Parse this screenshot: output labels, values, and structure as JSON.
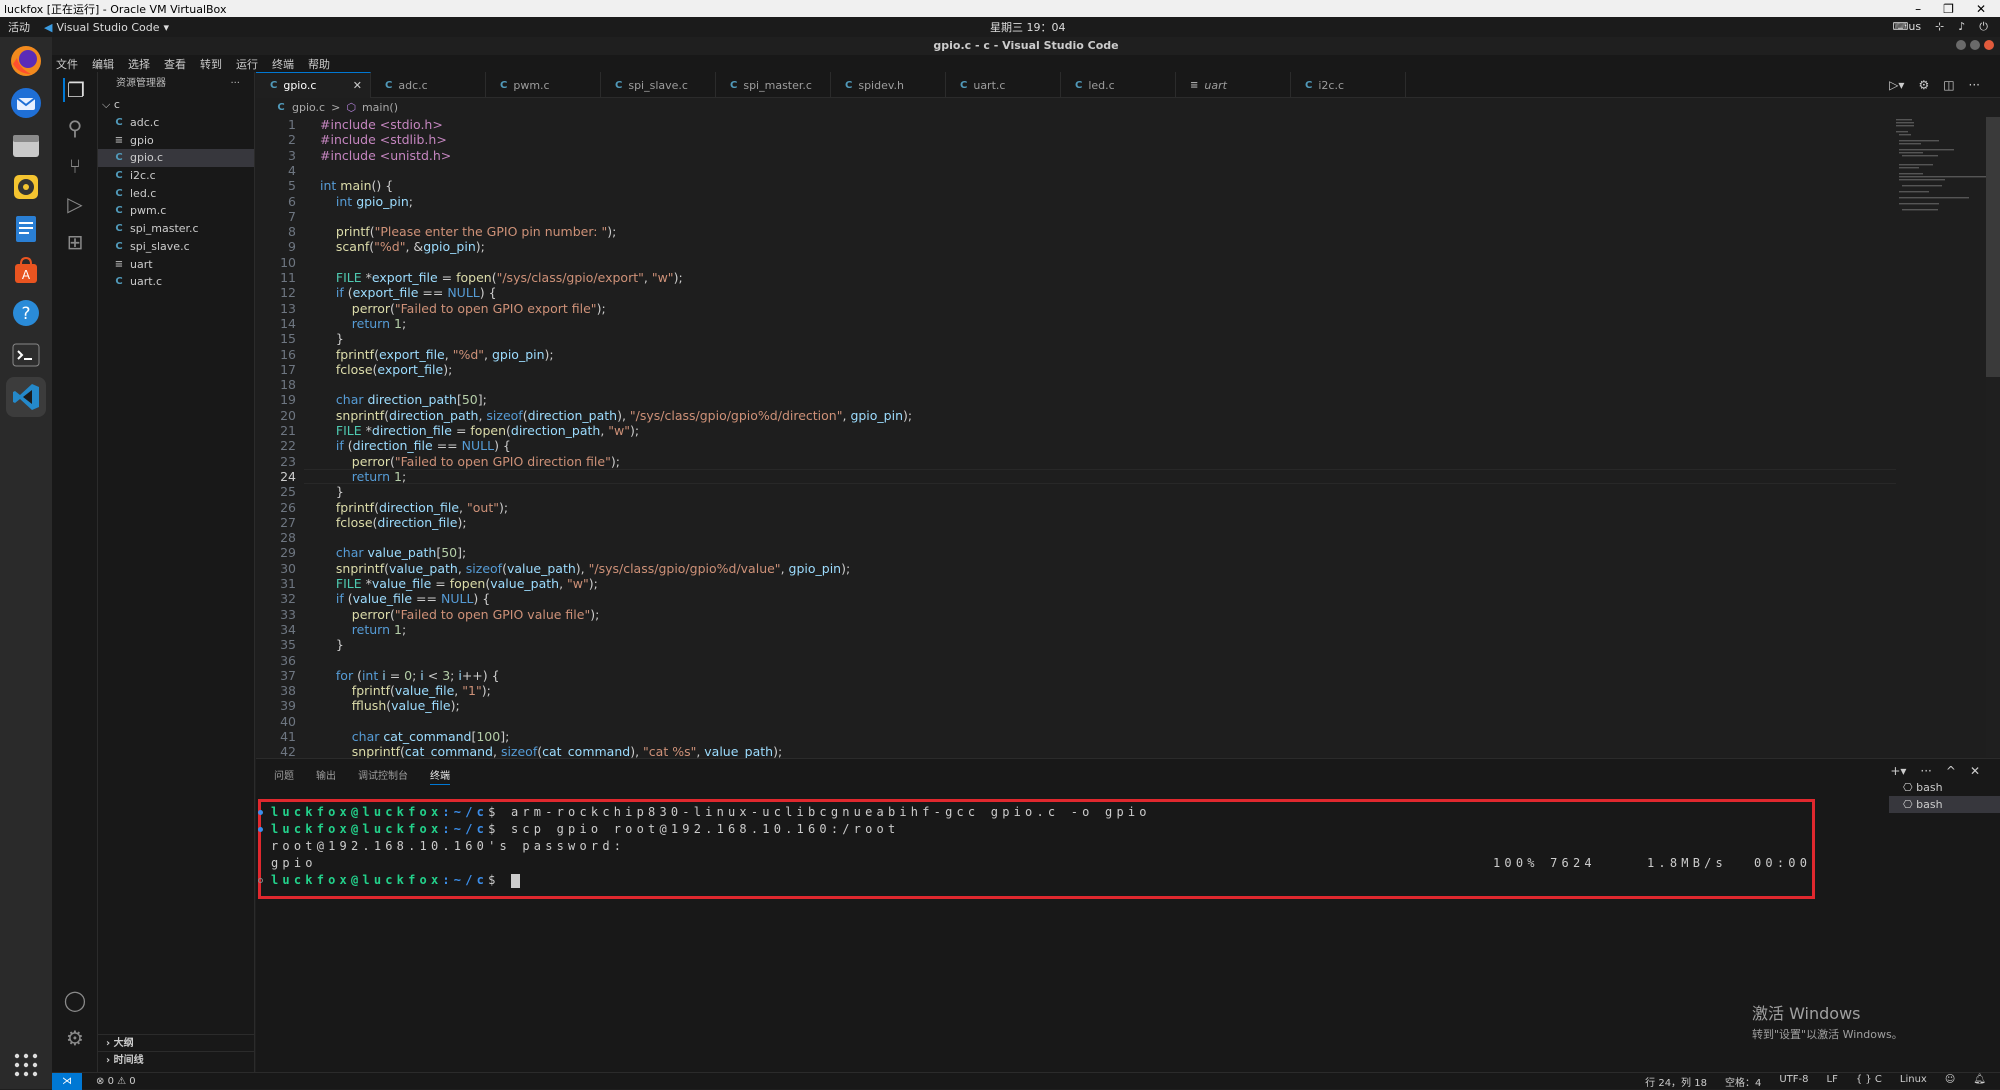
{
  "vbox": {
    "title": "luckfox [正在运行] - Oracle VM VirtualBox"
  },
  "gnome": {
    "activities": "活动",
    "app": "Visual Studio Code",
    "clock": "星期三 19：04",
    "lang": "us"
  },
  "window": {
    "title": "gpio.c - c - Visual Studio Code"
  },
  "menu": [
    "文件",
    "编辑",
    "选择",
    "查看",
    "转到",
    "运行",
    "终端",
    "帮助"
  ],
  "explorer": {
    "title": "资源管理器",
    "more": "···",
    "folder": "c",
    "files": [
      {
        "name": "adc.c",
        "type": "C"
      },
      {
        "name": "gpio",
        "type": "≡"
      },
      {
        "name": "gpio.c",
        "type": "C"
      },
      {
        "name": "i2c.c",
        "type": "C"
      },
      {
        "name": "led.c",
        "type": "C"
      },
      {
        "name": "pwm.c",
        "type": "C"
      },
      {
        "name": "spi_master.c",
        "type": "C"
      },
      {
        "name": "spi_slave.c",
        "type": "C"
      },
      {
        "name": "uart",
        "type": "≡"
      },
      {
        "name": "uart.c",
        "type": "C"
      }
    ],
    "outline": "大纲",
    "timeline": "时间线"
  },
  "tabs": [
    {
      "label": "gpio.c",
      "type": "C"
    },
    {
      "label": "adc.c",
      "type": "C"
    },
    {
      "label": "pwm.c",
      "type": "C"
    },
    {
      "label": "spi_slave.c",
      "type": "C"
    },
    {
      "label": "spi_master.c",
      "type": "C"
    },
    {
      "label": "spidev.h",
      "type": "C"
    },
    {
      "label": "uart.c",
      "type": "C"
    },
    {
      "label": "led.c",
      "type": "C"
    },
    {
      "label": "uart",
      "type": "≡"
    },
    {
      "label": "i2c.c",
      "type": "C"
    }
  ],
  "breadcrumb": {
    "file": "gpio.c",
    "sep": ">",
    "symbol": "main()"
  },
  "code": [
    "#include <stdio.h>",
    "#include <stdlib.h>",
    "#include <unistd.h>",
    "",
    "int main() {",
    "    int gpio_pin;",
    "",
    "    printf(\"Please enter the GPIO pin number: \");",
    "    scanf(\"%d\", &gpio_pin);",
    "",
    "    FILE *export_file = fopen(\"/sys/class/gpio/export\", \"w\");",
    "    if (export_file == NULL) {",
    "        perror(\"Failed to open GPIO export file\");",
    "        return 1;",
    "    }",
    "    fprintf(export_file, \"%d\", gpio_pin);",
    "    fclose(export_file);",
    "",
    "    char direction_path[50];",
    "    snprintf(direction_path, sizeof(direction_path), \"/sys/class/gpio/gpio%d/direction\", gpio_pin);",
    "    FILE *direction_file = fopen(direction_path, \"w\");",
    "    if (direction_file == NULL) {",
    "        perror(\"Failed to open GPIO direction file\");",
    "        return 1;",
    "    }",
    "    fprintf(direction_file, \"out\");",
    "    fclose(direction_file);",
    "",
    "    char value_path[50];",
    "    snprintf(value_path, sizeof(value_path), \"/sys/class/gpio/gpio%d/value\", gpio_pin);",
    "    FILE *value_file = fopen(value_path, \"w\");",
    "    if (value_file == NULL) {",
    "        perror(\"Failed to open GPIO value file\");",
    "        return 1;",
    "    }",
    "",
    "    for (int i = 0; i < 3; i++) {",
    "        fprintf(value_file, \"1\");",
    "        fflush(value_file);",
    "",
    "        char cat_command[100];",
    "        snprintf(cat_command, sizeof(cat_command), \"cat %s\", value_path);"
  ],
  "current_line": 24,
  "panel": {
    "tabs": [
      "问题",
      "输出",
      "调试控制台",
      "终端"
    ],
    "active": "终端"
  },
  "terminal": {
    "lines": [
      {
        "user": "luckfox@luckfox",
        "path": ":~/c",
        "prompt": "$ ",
        "cmd": "arm-rockchip830-linux-uclibcgnueabihf-gcc gpio.c -o gpio"
      },
      {
        "user": "luckfox@luckfox",
        "path": ":~/c",
        "prompt": "$ ",
        "cmd": "scp gpio root@192.168.10.160:/root"
      },
      {
        "text": "root@192.168.10.160's password:"
      },
      {
        "text": "gpio",
        "progress": "100% 7624",
        "rate": "1.8MB/s",
        "eta": "00:00"
      },
      {
        "user": "luckfox@luckfox",
        "path": ":~/c",
        "prompt": "$ ",
        "cmd": ""
      }
    ],
    "sessions": [
      "bash",
      "bash"
    ]
  },
  "watermark": {
    "line1": "激活 Windows",
    "line2": "转到\"设置\"以激活 Windows。"
  },
  "status": {
    "errors": "0",
    "warnings": "0",
    "position": "行 24，列 18",
    "spaces": "空格：4",
    "encoding": "UTF-8",
    "eol": "LF",
    "lang": "C",
    "os": "Linux"
  }
}
